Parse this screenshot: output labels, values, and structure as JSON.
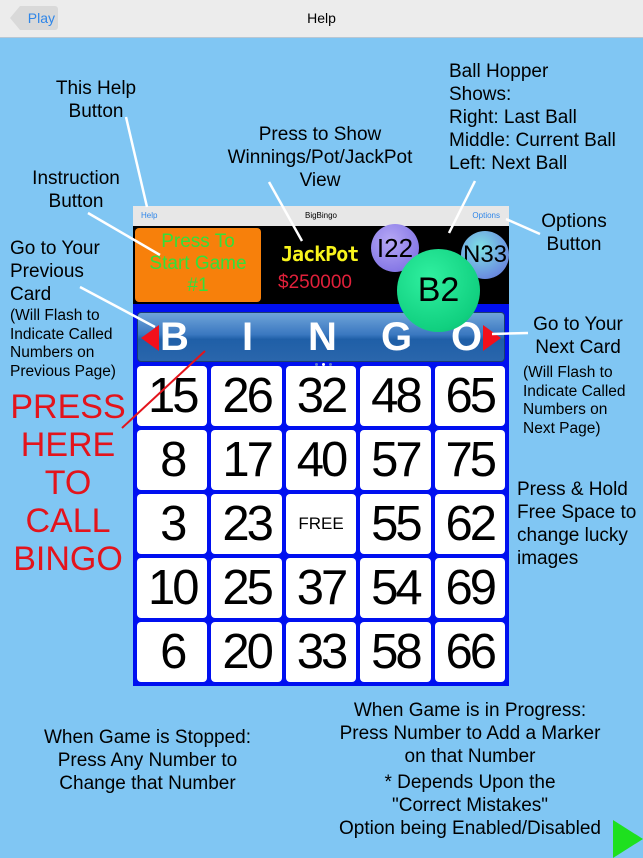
{
  "navbar": {
    "back_label": "Play",
    "title": "Help"
  },
  "annotations": {
    "help_button": "This Help Button",
    "instruction_button": "Instruction Button",
    "winnings_view": "Press to Show Winnings/Pot/JackPot View",
    "ball_hopper": [
      "Ball Hopper",
      "Shows:",
      "Right: Last Ball",
      "Middle: Current Ball",
      "Left: Next Ball"
    ],
    "options_button": "Options Button",
    "previous_card": "Go to Your Previous Card",
    "previous_card_note": "(Will Flash to Indicate Called Numbers on Previous Page)",
    "next_card": "Go to Your Next Card",
    "next_card_note": "(Will Flash to Indicate Called Numbers on Next Page)",
    "free_space": "Press & Hold Free Space to change lucky images",
    "call_bingo": [
      "PRESS",
      "HERE",
      "TO",
      "CALL",
      "BINGO"
    ],
    "game_stopped": [
      "When Game is Stopped:",
      "Press Any Number to",
      "Change that Number"
    ],
    "game_in_progress": [
      "When Game is in Progress:",
      "Press Number to Add a Marker",
      "on that Number"
    ],
    "depends_note": [
      "* Depends Upon the",
      "\"Correct Mistakes\"",
      "Option being Enabled/Disabled"
    ]
  },
  "app": {
    "help_label": "Help",
    "title": "BigBingo",
    "options_label": "Options",
    "start_button": [
      "Press To",
      "Start Game",
      "#1"
    ],
    "jackpot_title": "JackPot",
    "jackpot_amount": "$250000",
    "balls": {
      "next": "I22",
      "current": "B2",
      "last": "N33"
    },
    "header_letters": [
      "B",
      "I",
      "N",
      "G",
      "O"
    ],
    "card": [
      [
        "15",
        "26",
        "32",
        "48",
        "65"
      ],
      [
        "8",
        "17",
        "40",
        "57",
        "75"
      ],
      [
        "3",
        "23",
        "FREE",
        "55",
        "62"
      ],
      [
        "10",
        "25",
        "37",
        "54",
        "69"
      ],
      [
        "6",
        "20",
        "33",
        "58",
        "66"
      ]
    ]
  },
  "colors": {
    "background": "#80c6f3",
    "card_border": "#0010f0",
    "start_button": "#f7800b",
    "start_text": "#33e03a",
    "jackpot_title": "#f8f41c",
    "jackpot_amount": "#e0203a",
    "call_bingo_text": "#e3141c",
    "link_blue": "#2f86e8"
  }
}
